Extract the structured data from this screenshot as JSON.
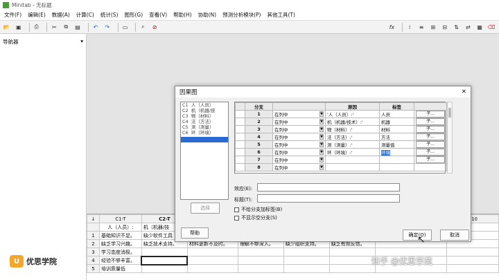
{
  "window": {
    "title": "Minitab - 无标题"
  },
  "menu": [
    "文件(F)",
    "编辑(E)",
    "数据(A)",
    "计算(C)",
    "统计(S)",
    "图形(G)",
    "查看(V)",
    "帮助(H)",
    "协助(N)",
    "预测分析模块(P)",
    "其他工具(T)"
  ],
  "toolbar": {
    "fx": "fx"
  },
  "navigator": {
    "title": "导航器",
    "arrow": "▾"
  },
  "dialog": {
    "title": "因果图",
    "close": "✕",
    "columns": [
      {
        "id": "C1",
        "name": "人（人员）"
      },
      {
        "id": "C2",
        "name": "机（机器/技"
      },
      {
        "id": "C3",
        "name": "物（材料）"
      },
      {
        "id": "C4",
        "name": "法（方法）"
      },
      {
        "id": "C5",
        "name": "测（测量）"
      },
      {
        "id": "C6",
        "name": "环（环境）"
      }
    ],
    "select_button": "选择",
    "help_button": "帮助",
    "ok_button": "确定(O)",
    "cancel_button": "取消",
    "table_headers": {
      "branch": "分支",
      "cause": "原因",
      "label": "标签"
    },
    "rows": [
      {
        "num": "1",
        "mode": "在列中",
        "cause": "'人（人员）:'",
        "label": "人员",
        "sub": "子..."
      },
      {
        "num": "2",
        "mode": "在列中",
        "cause": "机（机器/技术）:'",
        "label": "机器",
        "sub": "子..."
      },
      {
        "num": "3",
        "mode": "在列中",
        "cause": "物（材料）:'",
        "label": "材料",
        "sub": "子..."
      },
      {
        "num": "4",
        "mode": "在列中",
        "cause": "法（方法）:'",
        "label": "方法",
        "sub": "子..."
      },
      {
        "num": "5",
        "mode": "在列中",
        "cause": "测（测量）:'",
        "label": "测量值",
        "sub": "子..."
      },
      {
        "num": "6",
        "mode": "在列中",
        "cause": "环（环境）:'",
        "label": "环境",
        "sub": "子..."
      },
      {
        "num": "7",
        "mode": "在列中",
        "cause": "",
        "label": "",
        "sub": "子..."
      },
      {
        "num": "8",
        "mode": "在列中",
        "cause": "",
        "label": "",
        "sub": ""
      }
    ],
    "effect_label": "效应(E):",
    "title_label": "标题(T):",
    "check_no_branch_labels": "不给分支加标签(B)",
    "check_no_empty_branches": "不显示空分支(S)"
  },
  "sheet": {
    "row_marker": "↓",
    "col_headers": [
      "C1-T",
      "C2-T",
      "C10"
    ],
    "row0": [
      "人（人员）:",
      "机（机器/技"
    ],
    "rows": [
      {
        "n": "1",
        "cells": [
          "基础知识不足。",
          "缺少软件工具"
        ]
      },
      {
        "n": "2",
        "cells": [
          "缺乏学习兴趣。",
          "缺乏技术支持。",
          "材料更新不及时。",
          "理解不够深入。",
          "缺少组织支持。",
          "缺乏有效反馈。"
        ]
      },
      {
        "n": "3",
        "cells": [
          "学习态度消极。"
        ]
      },
      {
        "n": "4",
        "cells": [
          "经验不够丰富。"
        ]
      },
      {
        "n": "5",
        "cells": [
          "培训质量低"
        ]
      }
    ]
  },
  "watermarks": {
    "brand": "优思学院",
    "brand_mark": "U",
    "zhihu": "知乎 @优思学苑"
  }
}
